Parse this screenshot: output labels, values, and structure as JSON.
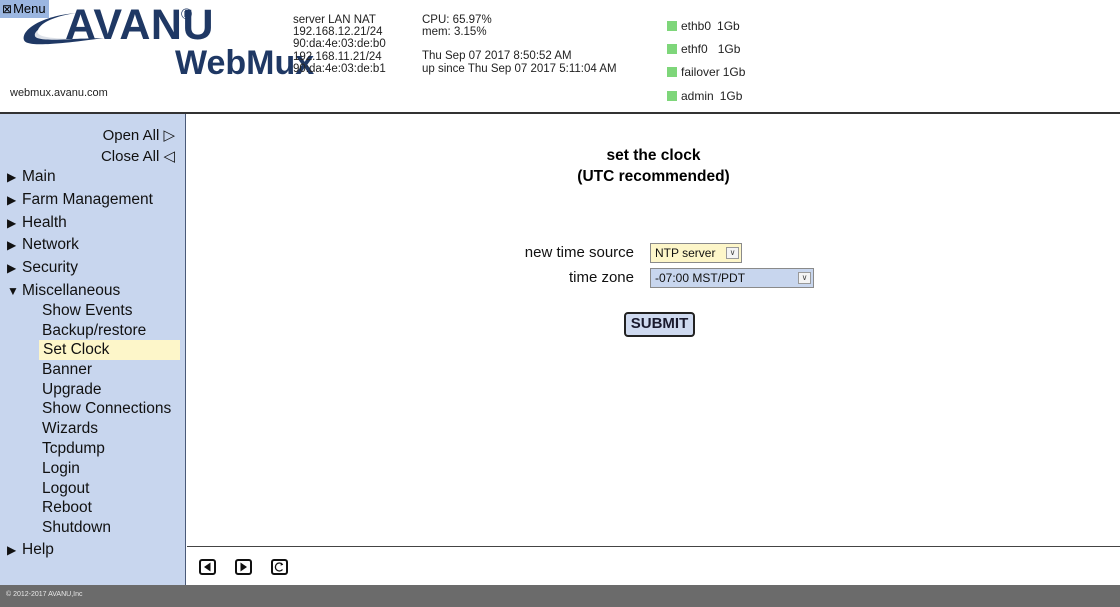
{
  "header": {
    "menu_label": "Menu",
    "brand_top": "AVANU",
    "brand_reg": "®",
    "brand_bottom": "WebMux",
    "site_url": "webmux.avanu.com",
    "server": {
      "type": "server LAN NAT",
      "ip1": "192.168.12.21/24",
      "mac1": "90:da:4e:03:de:b0",
      "ip2": "192.168.11.21/24",
      "mac2": "90:da:4e:03:de:b1"
    },
    "stats": {
      "cpu": "CPU: 65.97%",
      "mem": "mem: 3.15%",
      "datetime": "Thu Sep 07 2017 8:50:52 AM",
      "uptime": "up since Thu Sep 07 2017 5:11:04 AM"
    },
    "interfaces": [
      {
        "name": "ethb0",
        "speed": "1Gb"
      },
      {
        "name": "ethf0",
        "speed": "1Gb"
      },
      {
        "name": "failover",
        "speed": "1Gb"
      },
      {
        "name": "admin",
        "speed": "1Gb"
      }
    ],
    "colors": {
      "brand": "#1f3864",
      "link_ok": "#7ed67a"
    }
  },
  "sidebar": {
    "open_all": "Open All ▷",
    "close_all": "Close All ◁",
    "sections": [
      {
        "label": "Main",
        "arrow": "▶"
      },
      {
        "label": "Farm Management",
        "arrow": "▶"
      },
      {
        "label": "Health",
        "arrow": "▶"
      },
      {
        "label": "Network",
        "arrow": "▶"
      },
      {
        "label": "Security",
        "arrow": "▶"
      },
      {
        "label": "Miscellaneous",
        "arrow": "▼"
      },
      {
        "label": "Help",
        "arrow": "▶"
      }
    ],
    "misc_items": [
      "Show Events",
      "Backup/restore",
      "Set Clock",
      "Banner",
      "Upgrade",
      "Show Connections",
      "Wizards",
      "Tcpdump",
      "Login",
      "Logout",
      "Reboot",
      "Shutdown"
    ],
    "active_item": "Set Clock",
    "colors": {
      "background": "#c8d6ee",
      "active": "#fdf6c9"
    }
  },
  "main": {
    "title_line1": "set the clock",
    "title_line2": "(UTC recommended)",
    "form": {
      "time_source_label": "new time source",
      "time_source_value": "NTP server",
      "time_zone_label": "time zone",
      "time_zone_value": "-07:00 MST/PDT",
      "submit_label": "SUBMIT"
    }
  },
  "nav": {
    "icons": [
      "back-icon",
      "forward-icon",
      "refresh-icon"
    ]
  },
  "footer": {
    "copyright": "© 2012-2017 AVANU,Inc"
  }
}
